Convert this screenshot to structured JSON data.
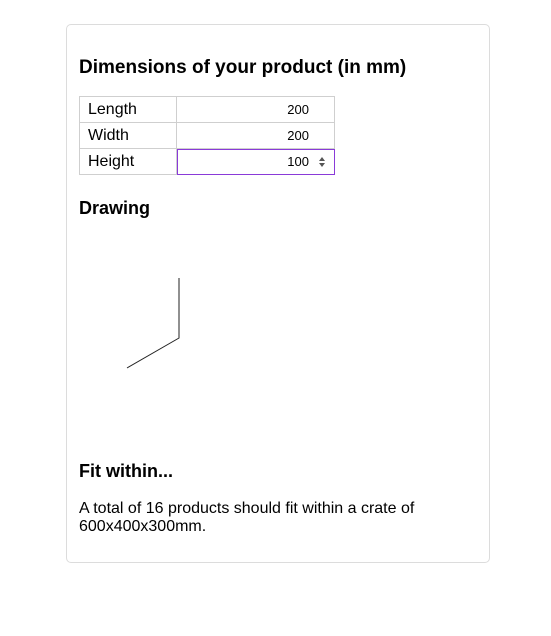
{
  "title": "Dimensions of your product (in mm)",
  "dimensions": [
    {
      "label": "Length",
      "value": "200"
    },
    {
      "label": "Width",
      "value": "200"
    },
    {
      "label": "Height",
      "value": "100"
    }
  ],
  "drawing": {
    "heading": "Drawing"
  },
  "fit": {
    "heading": "Fit within...",
    "text_before": "A total of ",
    "count": "16",
    "text_mid": " products should fit within a crate of ",
    "crate": "600x400x300mm",
    "text_after": "."
  },
  "colors": {
    "focus_border": "#8a3ad8",
    "card_border": "#dcdcdc",
    "table_border": "#cfcfcf"
  },
  "icons": {
    "spinner": "up-down-spinner-icon"
  }
}
